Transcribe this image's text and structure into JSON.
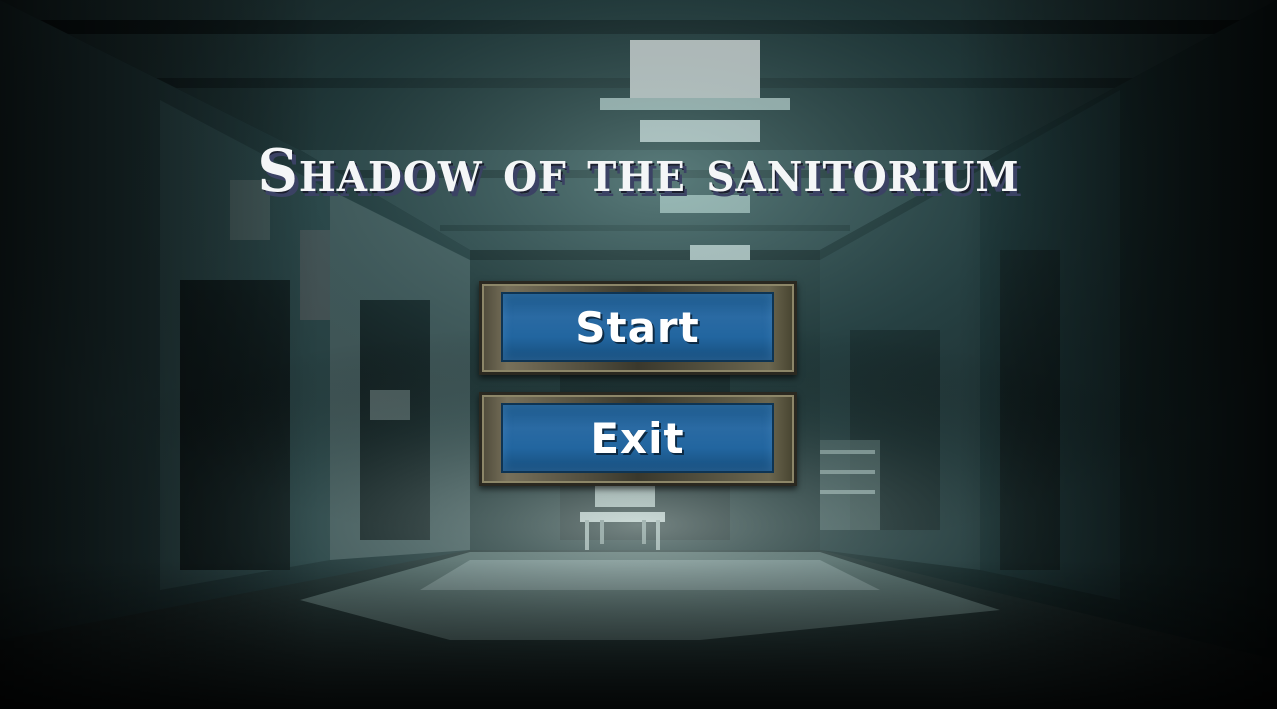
{
  "game": {
    "title": "Shadow of the sanitorium"
  },
  "menu": {
    "start_label": "Start",
    "exit_label": "Exit"
  },
  "colors": {
    "background_dark": "#050b0c",
    "corridor_teal": "#27474a",
    "ceiling_light": "#f7f3f1",
    "button_blue": "#2266a0",
    "button_frame": "#5a5644",
    "title_shadow": "#3b4264"
  }
}
